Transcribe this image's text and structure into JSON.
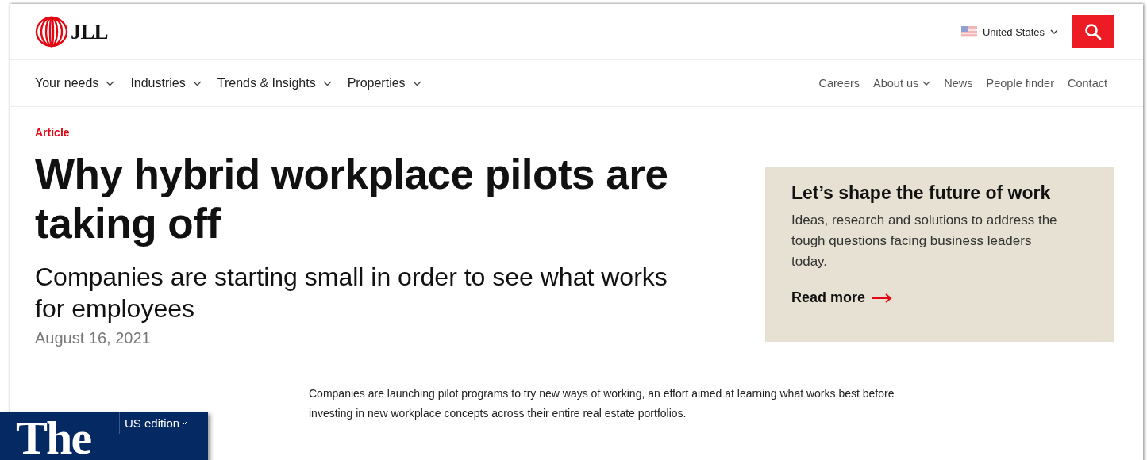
{
  "header": {
    "logo": "JLL",
    "region": "United States",
    "search_button": {
      "kind": "icon"
    }
  },
  "nav": {
    "main": [
      {
        "label": "Your needs",
        "dropdown": true
      },
      {
        "label": "Industries",
        "dropdown": true
      },
      {
        "label": "Trends & Insights",
        "dropdown": true
      },
      {
        "label": "Properties",
        "dropdown": true
      }
    ],
    "secondary": [
      {
        "label": "Careers",
        "dropdown": false
      },
      {
        "label": "About us",
        "dropdown": true
      },
      {
        "label": "News",
        "dropdown": false
      },
      {
        "label": "People finder",
        "dropdown": false
      },
      {
        "label": "Contact",
        "dropdown": false
      }
    ]
  },
  "article": {
    "category": "Article",
    "title": "Why hybrid workplace pilots are taking off",
    "subtitle": "Companies are starting small in order to see what works for employees",
    "date": "August 16, 2021",
    "intro": "Companies are launching pilot programs to try new ways of working, an effort aimed at learning what works best before investing in new workplace concepts across their entire real estate portfolios."
  },
  "promo": {
    "title": "Let’s shape the future of work",
    "text": "Ideas, research and solutions to address the tough questions facing business leaders today.",
    "link": "Read more"
  },
  "overlay": {
    "logo": "The",
    "edition": "US edition"
  }
}
